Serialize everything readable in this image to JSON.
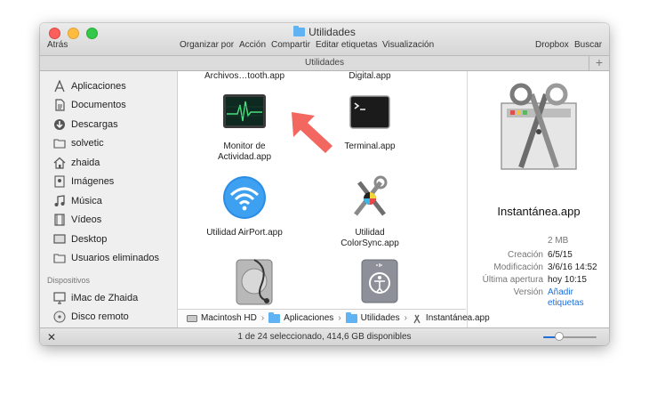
{
  "window": {
    "title": "Utilidades",
    "tab_title": "Utilidades"
  },
  "toolbar": {
    "back_label": "Atrás",
    "arrange_label": "Organizar por",
    "action_label": "Acción",
    "share_label": "Compartir",
    "tags_label": "Editar etiquetas",
    "view_label": "Visualización",
    "dropbox_label": "Dropbox",
    "search_label": "Buscar"
  },
  "sidebar": {
    "items": [
      {
        "label": "Aplicaciones",
        "icon": "applications-icon"
      },
      {
        "label": "Documentos",
        "icon": "documents-icon"
      },
      {
        "label": "Descargas",
        "icon": "downloads-icon"
      },
      {
        "label": "solvetic",
        "icon": "folder-icon"
      },
      {
        "label": "zhaida",
        "icon": "home-icon"
      },
      {
        "label": "Imágenes",
        "icon": "pictures-icon"
      },
      {
        "label": "Música",
        "icon": "music-icon"
      },
      {
        "label": "Vídeos",
        "icon": "movies-icon"
      },
      {
        "label": "Desktop",
        "icon": "desktop-icon"
      },
      {
        "label": "Usuarios eliminados",
        "icon": "folder-icon"
      }
    ],
    "devices_heading": "Dispositivos",
    "devices": [
      {
        "label": "iMac de Zhaida",
        "icon": "imac-icon"
      },
      {
        "label": "Disco remoto",
        "icon": "disc-icon"
      }
    ]
  },
  "files": {
    "top_left": "Archivos…tooth.app",
    "top_right": "Digital.app",
    "items": [
      {
        "line1": "Monitor de",
        "line2": "Actividad.app",
        "icon": "activity-monitor-icon"
      },
      {
        "line1": "Terminal.app",
        "line2": "",
        "icon": "terminal-icon"
      },
      {
        "line1": "Utilidad AirPort.app",
        "line2": "",
        "icon": "airport-utility-icon"
      },
      {
        "line1": "Utilidad",
        "line2": "ColorSync.app",
        "icon": "colorsync-icon"
      }
    ]
  },
  "preview": {
    "name": "Instantánea.app",
    "size": "2 MB",
    "created_label": "Creación",
    "created_value": "6/5/15",
    "modified_label": "Modificación",
    "modified_value": "3/6/16 14:52",
    "opened_label": "Última apertura",
    "opened_value": "hoy 10:15",
    "version_label": "Versión",
    "version_value": "Añadir etiquetas"
  },
  "path": {
    "crumbs": [
      "Macintosh HD",
      "Aplicaciones",
      "Utilidades",
      "Instantánea.app"
    ]
  },
  "status": {
    "text": "1 de 24 seleccionado, 414,6 GB disponibles",
    "zoom": 0.3
  },
  "colors": {
    "accent": "#1f6fd8",
    "arrow": "#f2675f",
    "folder": "#5fb3f3"
  }
}
